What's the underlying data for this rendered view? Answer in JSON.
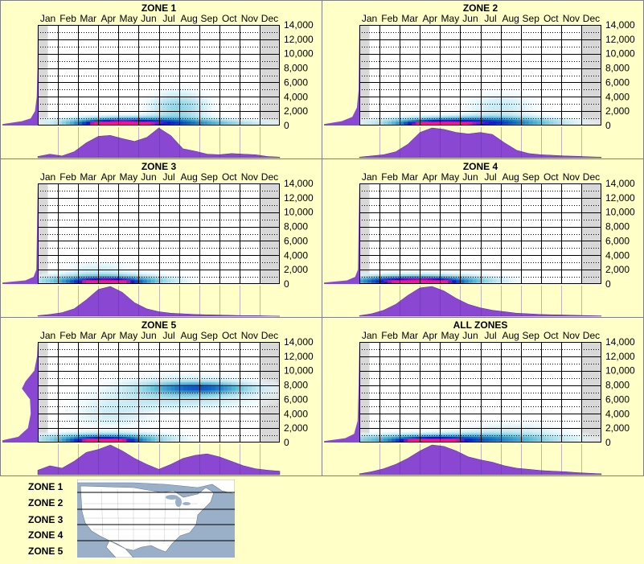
{
  "chart_data": [
    {
      "type": "heatmap",
      "title": "ZONE 1",
      "months": [
        "Jan",
        "Feb",
        "Mar",
        "Apr",
        "May",
        "Jun",
        "Jul",
        "Aug",
        "Sep",
        "Oct",
        "Nov",
        "Dec"
      ],
      "y_ticks": [
        "14,000",
        "12,000",
        "10,000",
        "8,000",
        "6,000",
        "4,000",
        "2,000",
        "0"
      ],
      "ylim": [
        0,
        14000
      ],
      "grid": true,
      "elevation_density": [
        [
          0,
          0
        ],
        [
          200,
          1.0
        ],
        [
          600,
          0.45
        ],
        [
          1000,
          0.2
        ],
        [
          2000,
          0.08
        ],
        [
          4000,
          0.03
        ],
        [
          8000,
          0.01
        ],
        [
          14000,
          0
        ]
      ],
      "monthly_density": [
        0.04,
        0.12,
        0.06,
        0.2,
        0.5,
        0.72,
        0.75,
        0.64,
        0.55,
        0.68,
        1.0,
        0.74,
        0.3,
        0.22,
        0.12,
        0.1,
        0.14,
        0.12,
        0.1,
        0.04,
        0.02
      ],
      "hotspots": [
        {
          "month": 4.3,
          "elev": 200,
          "intensity": 1.0,
          "spread_month": 1.0,
          "spread_elev": 300
        },
        {
          "month": 5.0,
          "elev": 400,
          "intensity": 0.7,
          "spread_month": 2.0,
          "spread_elev": 500
        },
        {
          "month": 7.5,
          "elev": 2500,
          "intensity": 0.22,
          "spread_month": 1.0,
          "spread_elev": 1500
        },
        {
          "month": 8.0,
          "elev": 300,
          "intensity": 0.3,
          "spread_month": 2.5,
          "spread_elev": 400
        }
      ]
    },
    {
      "type": "heatmap",
      "title": "ZONE 2",
      "months": [
        "Jan",
        "Feb",
        "Mar",
        "Apr",
        "May",
        "Jun",
        "Jul",
        "Aug",
        "Sep",
        "Oct",
        "Nov",
        "Dec"
      ],
      "y_ticks": [
        "14,000",
        "12,000",
        "10,000",
        "8,000",
        "6,000",
        "4,000",
        "2,000",
        "0"
      ],
      "ylim": [
        0,
        14000
      ],
      "grid": true,
      "elevation_density": [
        [
          0,
          0
        ],
        [
          200,
          1.0
        ],
        [
          600,
          0.5
        ],
        [
          1200,
          0.2
        ],
        [
          2500,
          0.07
        ],
        [
          5000,
          0.02
        ],
        [
          14000,
          0
        ]
      ],
      "monthly_density": [
        0.02,
        0.06,
        0.1,
        0.2,
        0.45,
        0.85,
        1.0,
        0.95,
        0.85,
        0.8,
        0.85,
        0.78,
        0.5,
        0.25,
        0.14,
        0.1,
        0.08,
        0.06,
        0.05,
        0.03,
        0.02
      ],
      "hotspots": [
        {
          "month": 4.3,
          "elev": 200,
          "intensity": 1.0,
          "spread_month": 1.0,
          "spread_elev": 300
        },
        {
          "month": 6.0,
          "elev": 400,
          "intensity": 0.8,
          "spread_month": 2.5,
          "spread_elev": 500
        },
        {
          "month": 7.5,
          "elev": 2500,
          "intensity": 0.12,
          "spread_month": 1.2,
          "spread_elev": 1500
        }
      ]
    },
    {
      "type": "heatmap",
      "title": "ZONE 3",
      "months": [
        "Jan",
        "Feb",
        "Mar",
        "Apr",
        "May",
        "Jun",
        "Jul",
        "Aug",
        "Sep",
        "Oct",
        "Nov",
        "Dec"
      ],
      "y_ticks": [
        "14,000",
        "12,000",
        "10,000",
        "8,000",
        "6,000",
        "4,000",
        "2,000",
        "0"
      ],
      "ylim": [
        0,
        14000
      ],
      "grid": true,
      "elevation_density": [
        [
          0,
          0
        ],
        [
          200,
          1.0
        ],
        [
          500,
          0.35
        ],
        [
          1000,
          0.12
        ],
        [
          2000,
          0.04
        ],
        [
          14000,
          0
        ]
      ],
      "monthly_density": [
        0.02,
        0.06,
        0.12,
        0.25,
        0.55,
        0.9,
        1.0,
        0.8,
        0.45,
        0.25,
        0.15,
        0.1,
        0.08,
        0.06,
        0.05,
        0.04,
        0.03,
        0.02,
        0.02,
        0.01,
        0.0
      ],
      "hotspots": [
        {
          "month": 3.9,
          "elev": 200,
          "intensity": 1.0,
          "spread_month": 1.0,
          "spread_elev": 300
        },
        {
          "month": 3.8,
          "elev": 500,
          "intensity": 0.6,
          "spread_month": 2.0,
          "spread_elev": 500
        },
        {
          "month": 3.5,
          "elev": 2000,
          "intensity": 0.1,
          "spread_month": 1.2,
          "spread_elev": 800
        }
      ]
    },
    {
      "type": "heatmap",
      "title": "ZONE 4",
      "months": [
        "Jan",
        "Feb",
        "Mar",
        "Apr",
        "May",
        "Jun",
        "Jul",
        "Aug",
        "Sep",
        "Oct",
        "Nov",
        "Dec"
      ],
      "y_ticks": [
        "14,000",
        "12,000",
        "10,000",
        "8,000",
        "6,000",
        "4,000",
        "2,000",
        "0"
      ],
      "ylim": [
        0,
        14000
      ],
      "grid": true,
      "elevation_density": [
        [
          0,
          0
        ],
        [
          200,
          1.0
        ],
        [
          500,
          0.35
        ],
        [
          1000,
          0.12
        ],
        [
          2000,
          0.04
        ],
        [
          14000,
          0
        ]
      ],
      "monthly_density": [
        0.02,
        0.08,
        0.2,
        0.4,
        0.7,
        0.95,
        1.0,
        0.85,
        0.6,
        0.4,
        0.28,
        0.2,
        0.15,
        0.1,
        0.08,
        0.06,
        0.05,
        0.04,
        0.03,
        0.02,
        0.01
      ],
      "hotspots": [
        {
          "month": 3.8,
          "elev": 200,
          "intensity": 1.0,
          "spread_month": 1.0,
          "spread_elev": 300
        },
        {
          "month": 3.5,
          "elev": 500,
          "intensity": 0.65,
          "spread_month": 2.2,
          "spread_elev": 500
        },
        {
          "month": 1.8,
          "elev": 300,
          "intensity": 0.3,
          "spread_month": 1.0,
          "spread_elev": 400
        }
      ]
    },
    {
      "type": "heatmap",
      "title": "ZONE 5",
      "months": [
        "Jan",
        "Feb",
        "Mar",
        "Apr",
        "May",
        "Jun",
        "Jul",
        "Aug",
        "Sep",
        "Oct",
        "Nov",
        "Dec"
      ],
      "y_ticks": [
        "14,000",
        "12,000",
        "10,000",
        "8,000",
        "6,000",
        "4,000",
        "2,000",
        "0"
      ],
      "ylim": [
        0,
        14000
      ],
      "grid": true,
      "elevation_density": [
        [
          0,
          0
        ],
        [
          300,
          1.0
        ],
        [
          800,
          0.55
        ],
        [
          2000,
          0.28
        ],
        [
          4000,
          0.2
        ],
        [
          6000,
          0.22
        ],
        [
          7500,
          0.45
        ],
        [
          8500,
          0.35
        ],
        [
          10000,
          0.1
        ],
        [
          12000,
          0.02
        ],
        [
          14000,
          0
        ]
      ],
      "monthly_density": [
        0.15,
        0.3,
        0.22,
        0.45,
        0.75,
        0.85,
        1.0,
        0.8,
        0.55,
        0.35,
        0.18,
        0.35,
        0.55,
        0.65,
        0.7,
        0.6,
        0.45,
        0.3,
        0.2,
        0.15,
        0.12
      ],
      "hotspots": [
        {
          "month": 3.8,
          "elev": 200,
          "intensity": 1.0,
          "spread_month": 1.0,
          "spread_elev": 300
        },
        {
          "month": 3.8,
          "elev": 500,
          "intensity": 0.55,
          "spread_month": 2.0,
          "spread_elev": 500
        },
        {
          "month": 8.5,
          "elev": 7600,
          "intensity": 0.45,
          "spread_month": 1.5,
          "spread_elev": 500
        },
        {
          "month": 7.8,
          "elev": 7000,
          "intensity": 0.2,
          "spread_month": 2.5,
          "spread_elev": 1500
        },
        {
          "month": 4.2,
          "elev": 4000,
          "intensity": 0.1,
          "spread_month": 1.5,
          "spread_elev": 1500
        }
      ]
    },
    {
      "type": "heatmap",
      "title": "ALL ZONES",
      "months": [
        "Jan",
        "Feb",
        "Mar",
        "Apr",
        "May",
        "Jun",
        "Jul",
        "Aug",
        "Sep",
        "Oct",
        "Nov",
        "Dec"
      ],
      "y_ticks": [
        "14,000",
        "12,000",
        "10,000",
        "8,000",
        "6,000",
        "4,000",
        "2,000",
        "0"
      ],
      "ylim": [
        0,
        14000
      ],
      "grid": true,
      "elevation_density": [
        [
          0,
          0
        ],
        [
          200,
          1.0
        ],
        [
          600,
          0.4
        ],
        [
          1200,
          0.15
        ],
        [
          3000,
          0.05
        ],
        [
          8000,
          0.02
        ],
        [
          14000,
          0
        ]
      ],
      "monthly_density": [
        0.03,
        0.1,
        0.2,
        0.35,
        0.55,
        0.8,
        1.0,
        0.95,
        0.8,
        0.6,
        0.5,
        0.42,
        0.3,
        0.22,
        0.18,
        0.14,
        0.12,
        0.1,
        0.07,
        0.05,
        0.03
      ],
      "hotspots": [
        {
          "month": 4.0,
          "elev": 200,
          "intensity": 1.0,
          "spread_month": 1.0,
          "spread_elev": 300
        },
        {
          "month": 5.0,
          "elev": 400,
          "intensity": 0.65,
          "spread_month": 3.0,
          "spread_elev": 500
        },
        {
          "month": 8.0,
          "elev": 1500,
          "intensity": 0.1,
          "spread_month": 2.0,
          "spread_elev": 1000
        }
      ]
    }
  ],
  "legend": {
    "zones": [
      "ZONE 1",
      "ZONE 2",
      "ZONE 3",
      "ZONE 4",
      "ZONE 5"
    ]
  },
  "colors": {
    "background": "#ffffc8",
    "density_fill": "#8a48d2",
    "border": "#808080",
    "shaded_month": "#d8d8d8",
    "heat_low": "#d0f0f8",
    "heat_mid": "#40a8c8",
    "heat_high": "#0010d0",
    "heat_peak": "#ff1090",
    "water": "#9ab0c8",
    "land": "#ffffff"
  }
}
